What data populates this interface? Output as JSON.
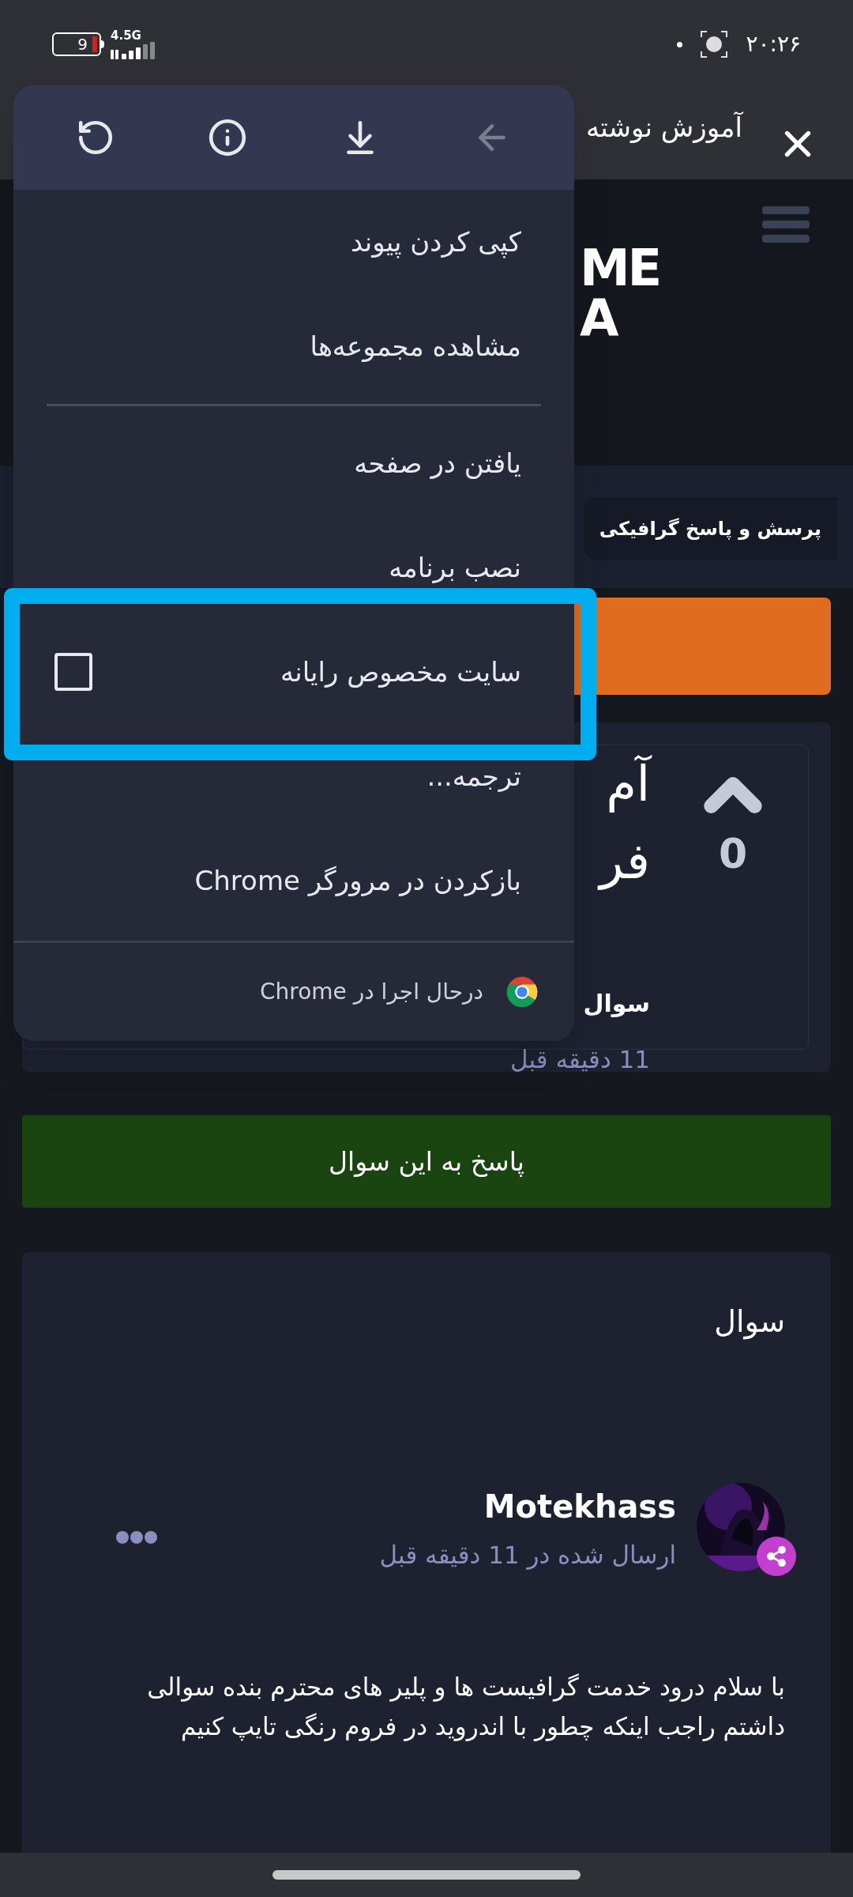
{
  "status_bar": {
    "battery": "9",
    "network": "4.5G",
    "time": "۲۰:۲۶"
  },
  "header": {
    "title": "آموزش نوشته"
  },
  "site": {
    "logo_top": "ME",
    "logo_bottom": "A",
    "breadcrumb": "پرسش و پاسخ گرافیکی"
  },
  "question": {
    "votes": "0",
    "title_lines": [
      "آم",
      "فر"
    ],
    "meta_label": "سوال",
    "time": "11 دقیقه قبل"
  },
  "answer_button": "پاسخ به این سوال",
  "post": {
    "heading": "سوال",
    "author": "Motekhass",
    "posted": "ارسال شده در 11 دقیقه قبل",
    "body": "با سلام درود خدمت گرافیست ها و پلیر های محترم بنده سوالی داشتم راجب اینکه چطور با اندروید در فروم رنگی تایپ کنیم"
  },
  "menu": {
    "toolbar": [
      {
        "kind": "reload",
        "disabled": false
      },
      {
        "kind": "info",
        "disabled": false
      },
      {
        "kind": "download",
        "disabled": false
      },
      {
        "kind": "back",
        "disabled": true
      }
    ],
    "items": [
      {
        "kind": "item",
        "label": "کپی کردن پیوند"
      },
      {
        "kind": "item",
        "label": "مشاهده مجموعه‌ها"
      },
      {
        "kind": "divider"
      },
      {
        "kind": "item",
        "label": "یافتن در صفحه"
      },
      {
        "kind": "item",
        "label": "نصب برنامه"
      },
      {
        "kind": "checkbox",
        "label": "سایت مخصوص رایانه",
        "checked": false,
        "highlighted": true
      },
      {
        "kind": "item",
        "label": "ترجمه..."
      },
      {
        "kind": "item",
        "label": "بازکردن در مرورگر Chrome"
      }
    ],
    "footer": "درحال اجرا در Chrome"
  }
}
